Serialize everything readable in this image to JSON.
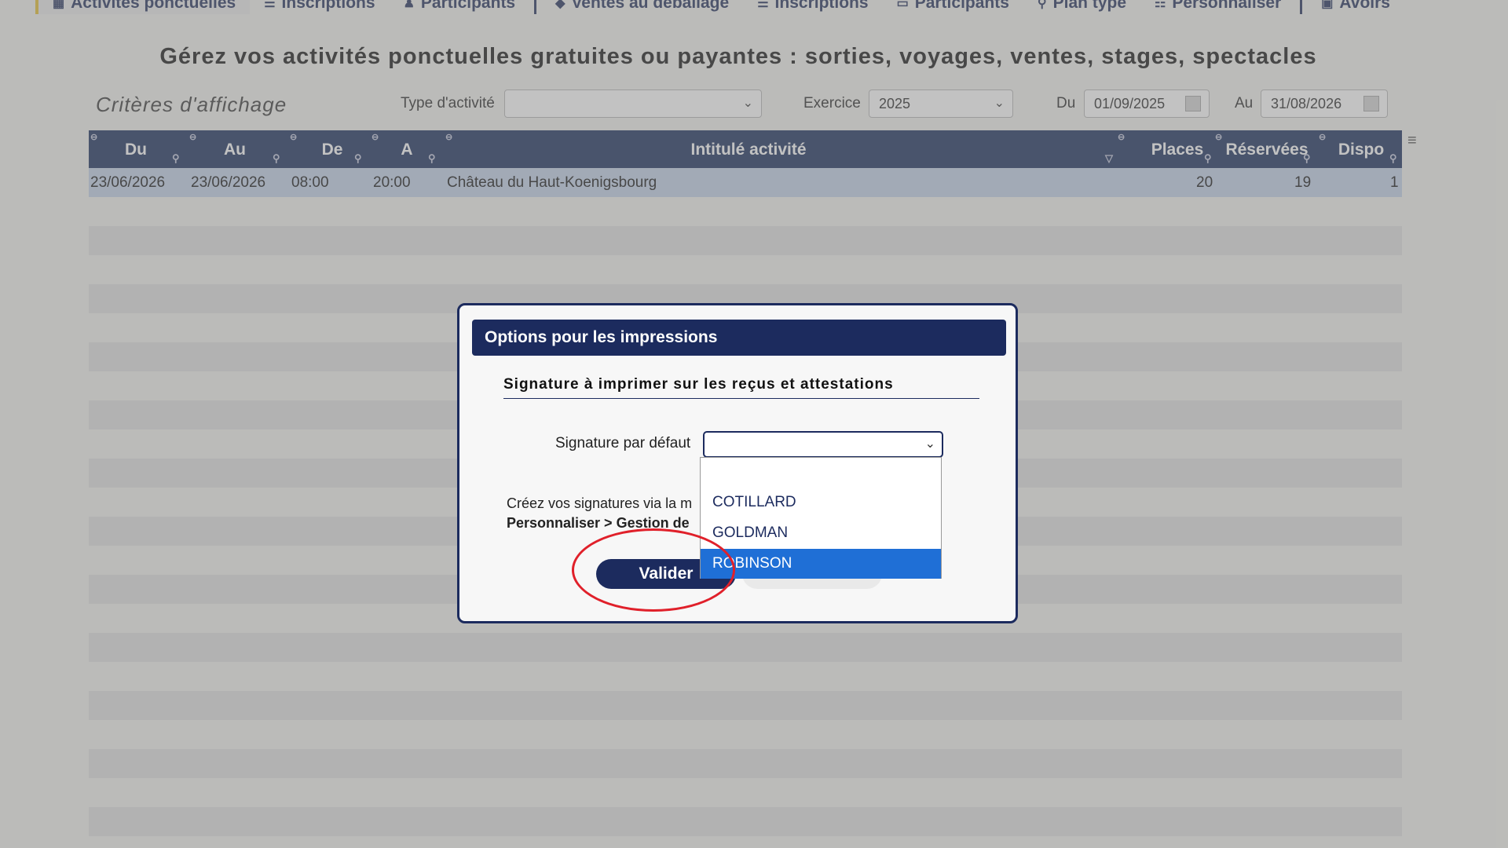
{
  "nav": {
    "tabs": [
      {
        "label": "Activités ponctuelles",
        "icon": "calendar-icon"
      },
      {
        "label": "Inscriptions",
        "icon": "list-icon"
      },
      {
        "label": "Participants",
        "icon": "person-icon"
      },
      {
        "label": "Ventes au déballage",
        "icon": "tag-icon"
      },
      {
        "label": "Inscriptions",
        "icon": "list-icon"
      },
      {
        "label": "Participants",
        "icon": "card-icon"
      },
      {
        "label": "Plan type",
        "icon": "pin-icon"
      },
      {
        "label": "Personnaliser",
        "icon": "sliders-icon"
      },
      {
        "label": "Avoirs",
        "icon": "wallet-icon"
      }
    ]
  },
  "page": {
    "title": "Gérez vos activités ponctuelles gratuites ou payantes : sorties, voyages, ventes, stages, spectacles"
  },
  "filters": {
    "criteria_label": "Critères d'affichage",
    "type_label": "Type d'activité",
    "type_value": "",
    "exercice_label": "Exercice",
    "exercice_value": "2025",
    "du_label": "Du",
    "du_value": "01/09/2025",
    "au_label": "Au",
    "au_value": "31/08/2026"
  },
  "grid": {
    "columns": [
      "Du",
      "Au",
      "De",
      "A",
      "Intitulé activité",
      "Places",
      "Réservées",
      "Dispo"
    ],
    "rows": [
      {
        "du": "23/06/2026",
        "au": "23/06/2026",
        "de": "08:00",
        "a": "20:00",
        "intitule": "Château du Haut-Koenigsbourg",
        "places": "20",
        "reservees": "19",
        "dispo": "1"
      }
    ]
  },
  "modal": {
    "title": "Options pour les impressions",
    "section_title": "Signature à imprimer sur les reçus et attestations",
    "signature_label": "Signature par défaut",
    "signature_value": "",
    "note_line1": "Créez vos signatures via la m",
    "note_line2_bold": "Personnaliser > Gestion de",
    "valider_label": "Valider",
    "options": [
      "",
      "COTILLARD",
      "GOLDMAN",
      "ROBINSON"
    ],
    "highlighted_option": "ROBINSON"
  },
  "colors": {
    "navy": "#1c2b5e",
    "header": "#243763",
    "highlight": "#1f6fd6",
    "annotation": "#e0202a"
  }
}
